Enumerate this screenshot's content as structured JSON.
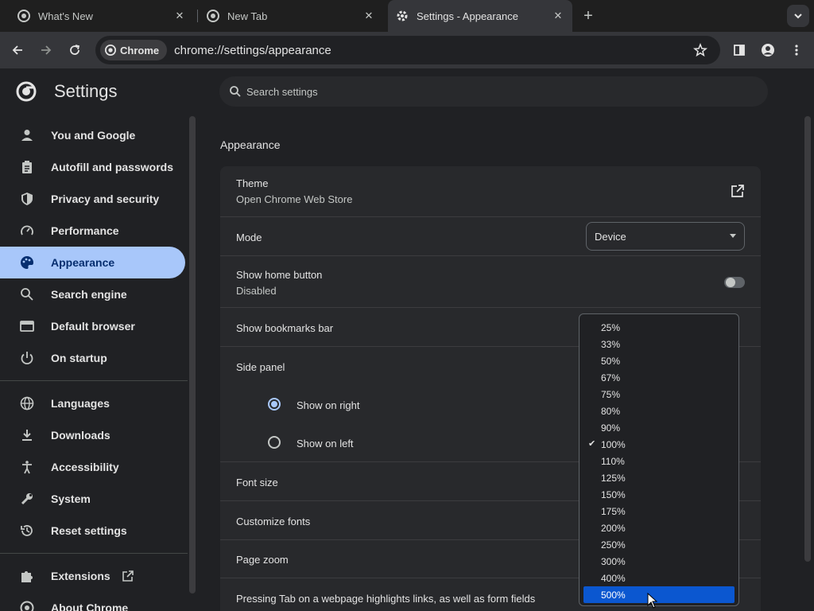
{
  "tabs": [
    {
      "title": "What's New",
      "active": false
    },
    {
      "title": "New Tab",
      "active": false
    },
    {
      "title": "Settings - Appearance",
      "active": true
    }
  ],
  "toolbar": {
    "chip_label": "Chrome",
    "url": "chrome://settings/appearance"
  },
  "header": {
    "title": "Settings",
    "search_placeholder": "Search settings"
  },
  "sidebar": {
    "group1": [
      {
        "label": "You and Google",
        "icon": "person-icon"
      },
      {
        "label": "Autofill and passwords",
        "icon": "clipboard-icon"
      },
      {
        "label": "Privacy and security",
        "icon": "shield-icon"
      },
      {
        "label": "Performance",
        "icon": "gauge-icon"
      },
      {
        "label": "Appearance",
        "icon": "palette-icon",
        "active": true
      },
      {
        "label": "Search engine",
        "icon": "search-icon"
      },
      {
        "label": "Default browser",
        "icon": "browser-icon"
      },
      {
        "label": "On startup",
        "icon": "power-icon"
      }
    ],
    "group2": [
      {
        "label": "Languages",
        "icon": "globe-icon"
      },
      {
        "label": "Downloads",
        "icon": "download-icon"
      },
      {
        "label": "Accessibility",
        "icon": "accessibility-icon"
      },
      {
        "label": "System",
        "icon": "wrench-icon"
      },
      {
        "label": "Reset settings",
        "icon": "history-icon"
      }
    ],
    "extensions": "Extensions",
    "about": "About Chrome"
  },
  "appearance": {
    "section_title": "Appearance",
    "theme_label": "Theme",
    "theme_sub": "Open Chrome Web Store",
    "mode_label": "Mode",
    "mode_value": "Device",
    "home_label": "Show home button",
    "home_sub": "Disabled",
    "bookmarks_label": "Show bookmarks bar",
    "side_panel_label": "Side panel",
    "show_right": "Show on right",
    "show_left": "Show on left",
    "font_size_label": "Font size",
    "customize_fonts_label": "Customize fonts",
    "page_zoom_label": "Page zoom",
    "tab_highlight_label": "Pressing Tab on a webpage highlights links, as well as form fields"
  },
  "zoom_options": [
    "25%",
    "33%",
    "50%",
    "67%",
    "75%",
    "80%",
    "90%",
    "100%",
    "110%",
    "125%",
    "150%",
    "175%",
    "200%",
    "250%",
    "300%",
    "400%",
    "500%"
  ],
  "zoom_checked": "100%",
  "zoom_highlighted": "500%",
  "colors": {
    "accent": "#a8c7fa",
    "highlight": "#0b57d0",
    "background": "#202124"
  }
}
